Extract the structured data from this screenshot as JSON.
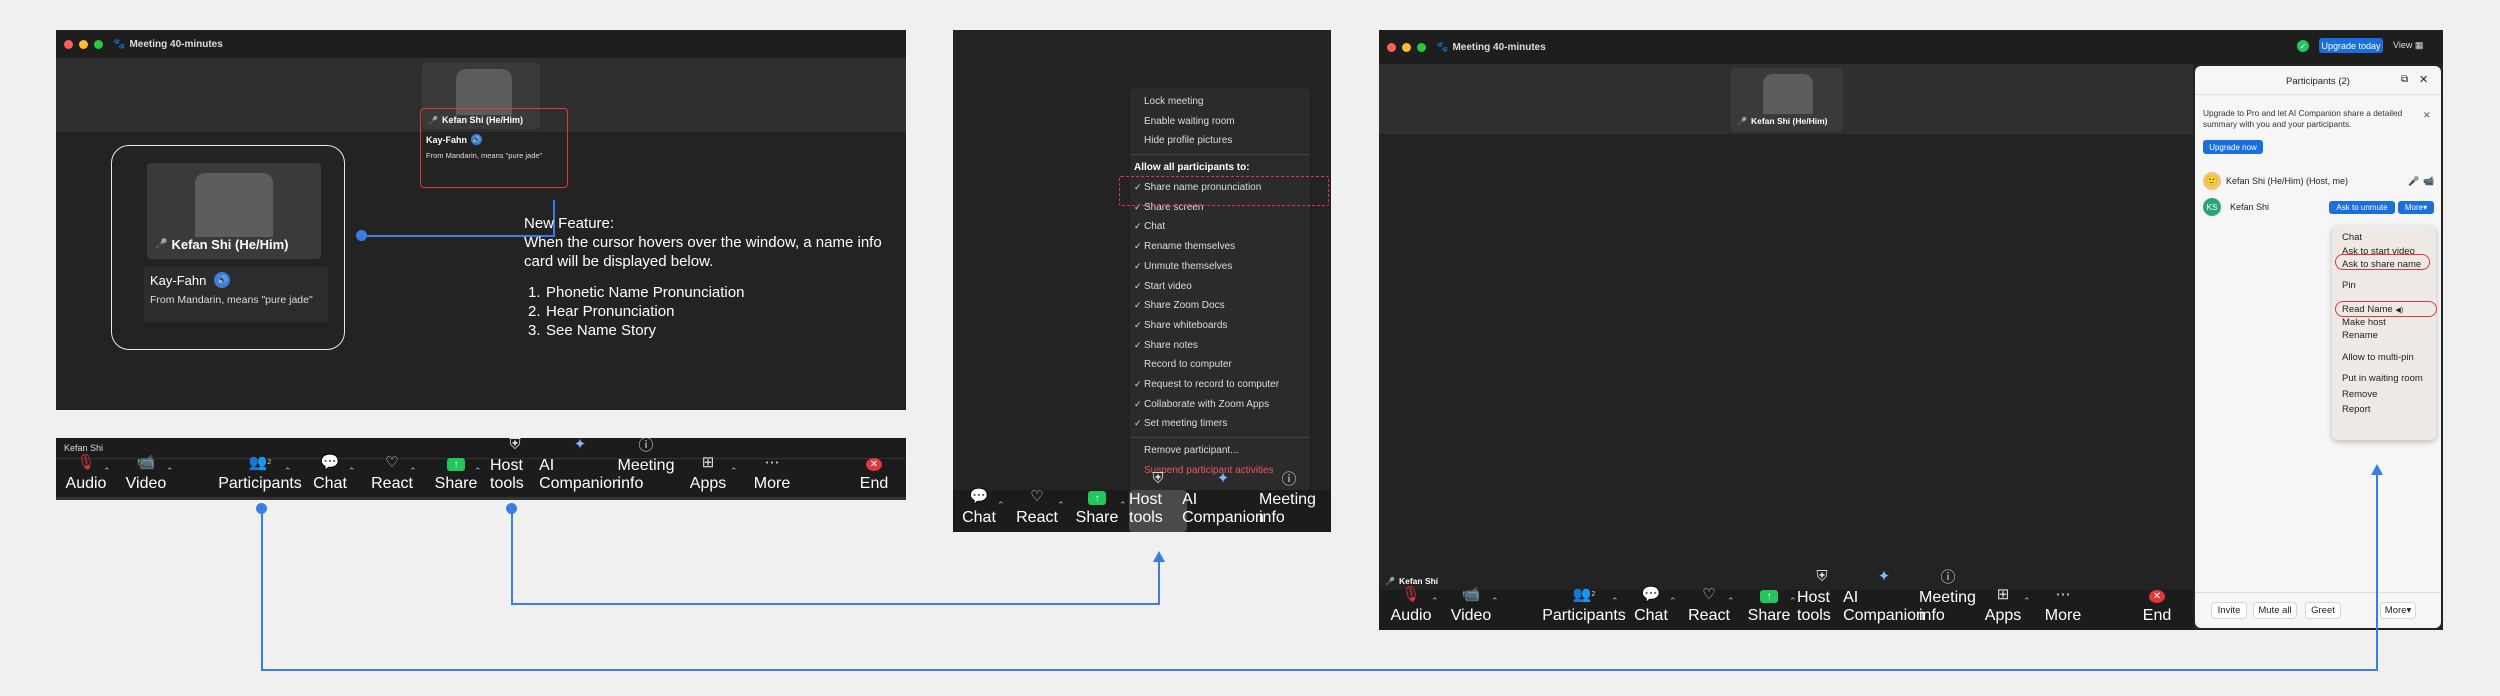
{
  "window1": {
    "title": "Meeting  40-minutes",
    "thumb_name": "Kefan Shi (He/Him)",
    "card_small_name": "Kay-Fahn",
    "card_small_meaning": "From Mandarin, means \"pure jade\"",
    "zoom_name": "Kefan Shi (He/Him)",
    "zoom_card_name": "Kay-Fahn",
    "zoom_card_meaning": "From Mandarin, means \"pure jade\"",
    "feature_heading": "New Feature:",
    "feature_desc": "When the cursor hovers over the window, a name info card will be displayed below.",
    "feature_list": [
      "Phonetic Name Pronunciation",
      "Hear Pronunciation",
      "See Name Story"
    ],
    "feature_list_nums": [
      "1.",
      "2.",
      "3."
    ]
  },
  "toolbar1": {
    "user": "Kefan Shi",
    "items": [
      "Audio",
      "Video",
      "Participants",
      "Chat",
      "React",
      "Share",
      "Host tools",
      "AI Companion",
      "Meeting info",
      "Apps",
      "More",
      "End"
    ],
    "participant_count": "2"
  },
  "host_menu": {
    "top_items": [
      "Lock meeting",
      "Enable waiting room",
      "Hide profile pictures"
    ],
    "allow_heading": "Allow all participants to:",
    "checked_items": [
      "Share name pronunciation",
      "Share screen",
      "Chat",
      "Rename themselves",
      "Unmute themselves",
      "Start video",
      "Share Zoom Docs",
      "Share whiteboards",
      "Share notes"
    ],
    "unchecked_item": "Record to computer",
    "checked_items2": [
      "Request to record to computer",
      "Collaborate with Zoom Apps",
      "Set meeting timers"
    ],
    "remove": "Remove participant...",
    "suspend": "Suspend participant activities",
    "toolbar": [
      "Chat",
      "React",
      "Share",
      "Host tools",
      "AI Companion",
      "Meeting info"
    ]
  },
  "window3": {
    "title": "Meeting  40-minutes",
    "upgrade_btn": "Upgrade today",
    "view": "View",
    "thumb_name": "Kefan Shi (He/Him)",
    "user": "Kefan Shi",
    "toolbar": [
      "Audio",
      "Video",
      "Participants",
      "Chat",
      "React",
      "Share",
      "Host tools",
      "AI Companion",
      "Meeting info",
      "Apps",
      "More",
      "End"
    ],
    "participant_count": "2"
  },
  "participants": {
    "title": "Participants (2)",
    "banner": "Upgrade to Pro and let AI Companion share a detailed summary with you and your participants.",
    "upgrade_now": "Upgrade now",
    "host_name": "Kefan Shi (He/Him) (Host, me)",
    "guest_initials": "KS",
    "guest_name": "Kefan Shi",
    "ask_unmute": "Ask to unmute",
    "more": "More",
    "menu": [
      "Chat",
      "Ask to start video",
      "Ask to share name",
      "Pin",
      "Read Name",
      "Make host",
      "Rename",
      "Allow to multi-pin",
      "Put in waiting room",
      "Remove",
      "Report"
    ],
    "footer": [
      "Invite",
      "Mute all",
      "Greet",
      "More"
    ]
  },
  "colors": {
    "accent_blue": "#3b7de6",
    "highlight_red": "#e0373d",
    "share_green": "#22c55e"
  }
}
